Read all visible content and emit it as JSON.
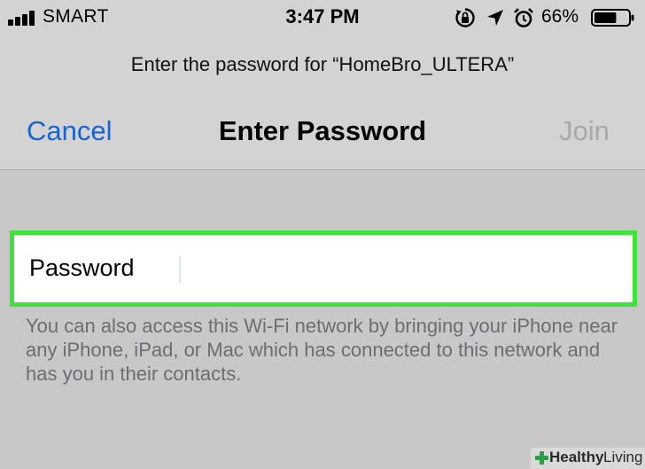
{
  "status_bar": {
    "carrier": "SMART",
    "time": "3:47 PM",
    "battery_percent": "66%",
    "battery_level": 0.66,
    "signal_bars": 4,
    "icons": [
      "signal-bars-icon",
      "orientation-lock-icon",
      "location-arrow-icon",
      "alarm-clock-icon",
      "battery-icon"
    ]
  },
  "header": {
    "prompt": "Enter the password for “HomeBro_ULTERA”",
    "cancel_label": "Cancel",
    "title": "Enter Password",
    "join_label": "Join"
  },
  "password_field": {
    "label": "Password",
    "value": "",
    "highlight_color": "#3ee23b"
  },
  "helper_text": "You can also access this Wi-Fi network by bringing your iPhone near any iPhone, iPad, or Mac which has connected to this network and has you in their contacts.",
  "watermark": {
    "bold": "Healthy",
    "regular": "Living"
  },
  "colors": {
    "accent": "#1a63d3",
    "disabled": "#a9a9ab",
    "background": "#c8c8c9",
    "header_background": "#d3d3d4"
  }
}
